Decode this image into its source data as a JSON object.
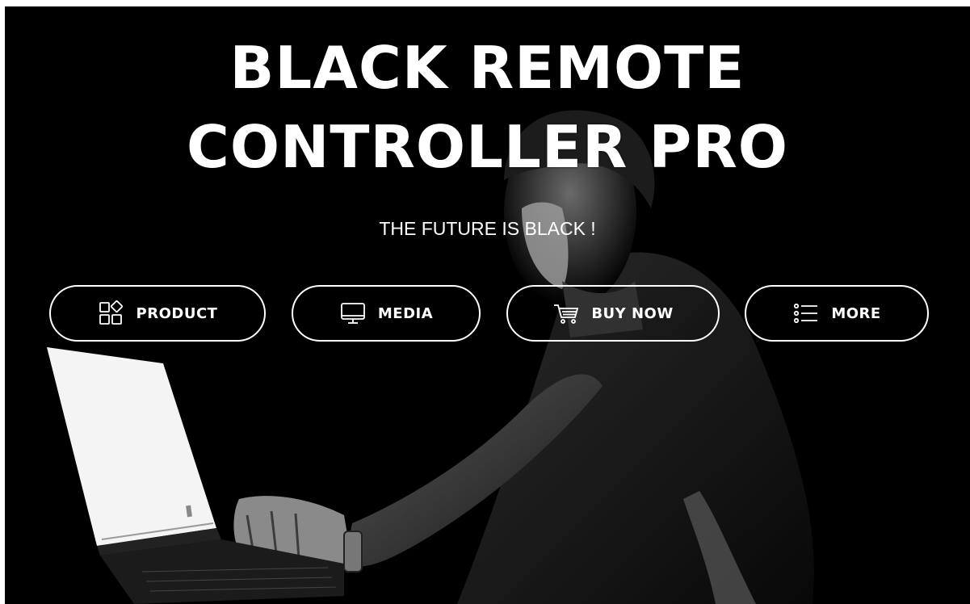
{
  "hero": {
    "title_line1": "BLACK REMOTE",
    "title_line2": "CONTROLLER PRO",
    "subtitle": "THE FUTURE IS BLACK !"
  },
  "nav": {
    "items": [
      {
        "label": "PRODUCT",
        "icon": "product-grid-icon"
      },
      {
        "label": "MEDIA",
        "icon": "monitor-icon"
      },
      {
        "label": "BUY NOW",
        "icon": "shopping-cart-icon"
      },
      {
        "label": "MORE",
        "icon": "list-icon"
      }
    ]
  },
  "colors": {
    "background": "#000000",
    "text": "#ffffff",
    "button_border": "#ffffff"
  }
}
